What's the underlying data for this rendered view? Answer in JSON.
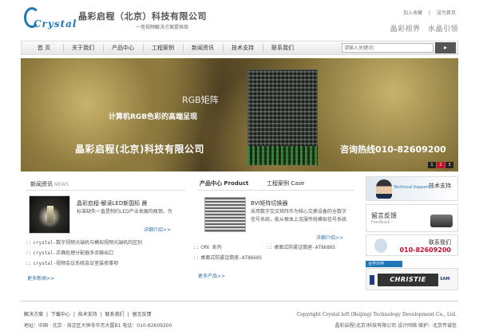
{
  "header": {
    "logo_text": "Crystal",
    "company_name": "晶彩启程（北京）科技有限公司",
    "slogan": "一音视频解决方案提供商",
    "top_links": [
      "加入收藏",
      "|",
      "设为首页"
    ],
    "motto": [
      "晶彩视界",
      "水晶引领"
    ]
  },
  "nav": {
    "items": [
      "首 页",
      "关于我们",
      "产品中心",
      "工程案例",
      "新闻资讯",
      "技术支持",
      "联系我们"
    ],
    "search_placeholder": "请输入关键词：",
    "search_button": "▸"
  },
  "banner": {
    "heading": "RGB矩阵",
    "sub": "计算机RGB色彩的高端呈现",
    "company": "晶彩启程(北京)科技有限公司",
    "hotline": "咨询热线010-82609200",
    "dots": [
      "1",
      "2",
      "3"
    ]
  },
  "news": {
    "title": "新闻资讯",
    "title_en": "NEWS",
    "featured_head": "晶彩启程-解读LED新国标 晨",
    "featured_desc": "标准缺失一直是制约LED产业发展的瓶颈。为",
    "detail_link": "详细介绍>>",
    "items": [
      "crystal-数字视频光端机与模拟视频光端机的区别",
      "crystal-正确处理分配器多余输出口",
      "crystal-视频会议系统会议室装修事项"
    ],
    "more_link": "更多新闻>>"
  },
  "products": {
    "tab_product": "产品中心 Product",
    "tab_case": "工程案例 Case",
    "featured_head": "BVI矩阵切换器",
    "featured_desc": "采用数字交叉矩阵作为核心交换设备的全数字信号系统，能从根本上克服传统模拟信号系统",
    "detail_link": "详细介绍>>",
    "items_left": [
      "CMX 系列",
      "桌面式防雾话筒座-AT8668S"
    ],
    "items_right": [
      "桌面式防雾话筒座-AT8688S"
    ],
    "more_link": "更多产品>>"
  },
  "sidebar": {
    "tech_tag": "Technical Support",
    "tech_title": "技术支持",
    "feedback_title": "留言反馈",
    "feedback_sub": "Feedback",
    "contact_title": "联系我们",
    "contact_phone": "010-82609200",
    "partner_label": "合作伙伴",
    "partner_main": "CHRISTIE",
    "partner_side": "SAM"
  },
  "footer": {
    "links": [
      "解决方案",
      "|",
      "下载中心",
      "|",
      "技术支持",
      "|",
      "联系我们",
      "|",
      "留言反馈"
    ],
    "address": "地址：中国 · 北京 · 海淀区大钟寺华杰大厦B1 电话：010-82609200",
    "copyright": "Copyright Crystal left (Beijing) Technology Development Co., Ltd.",
    "copyright2": "晶彩启程(北京)科技有限公司 设计同络 维护：北京传诚信"
  },
  "colors": {
    "brand": "#1f76b8",
    "accent": "#c8102e"
  }
}
